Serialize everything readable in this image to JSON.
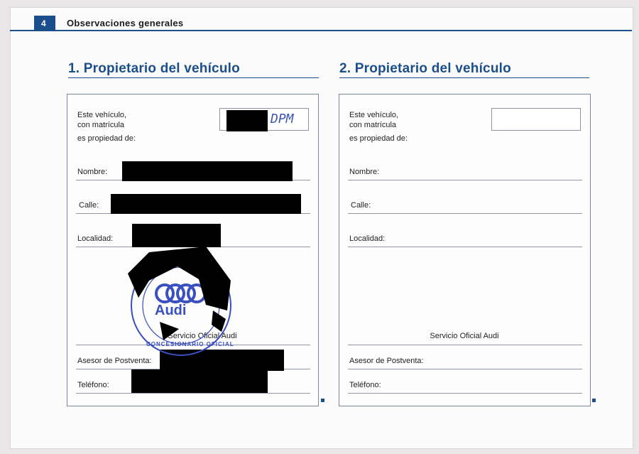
{
  "header": {
    "page_number": "4",
    "title": "Observaciones generales"
  },
  "sections": [
    {
      "title": "1. Propietario del vehículo",
      "labels": {
        "vehicle_line1": "Este vehículo,",
        "vehicle_line2": "con matrícula",
        "owned_by": "es propiedad de:",
        "name": "Nombre:",
        "street": "Calle:",
        "city": "Localidad:",
        "service": "Servicio Oficial Audi",
        "advisor": "Asesor de Postventa:",
        "phone": "Teléfono:"
      },
      "plate_handwritten": "DPM"
    },
    {
      "title": "2. Propietario del vehículo",
      "labels": {
        "vehicle_line1": "Este vehículo,",
        "vehicle_line2": "con matrícula",
        "owned_by": "es propiedad de:",
        "name": "Nombre:",
        "street": "Calle:",
        "city": "Localidad:",
        "service": "Servicio Oficial Audi",
        "advisor": "Asesor de Postventa:",
        "phone": "Teléfono:"
      }
    }
  ],
  "stamp": {
    "brand": "Audi",
    "text": "CONCESIONARIO OFICIAL"
  },
  "colors": {
    "brand_blue": "#1b4f8c",
    "stamp_blue": "#3a4fc0"
  }
}
